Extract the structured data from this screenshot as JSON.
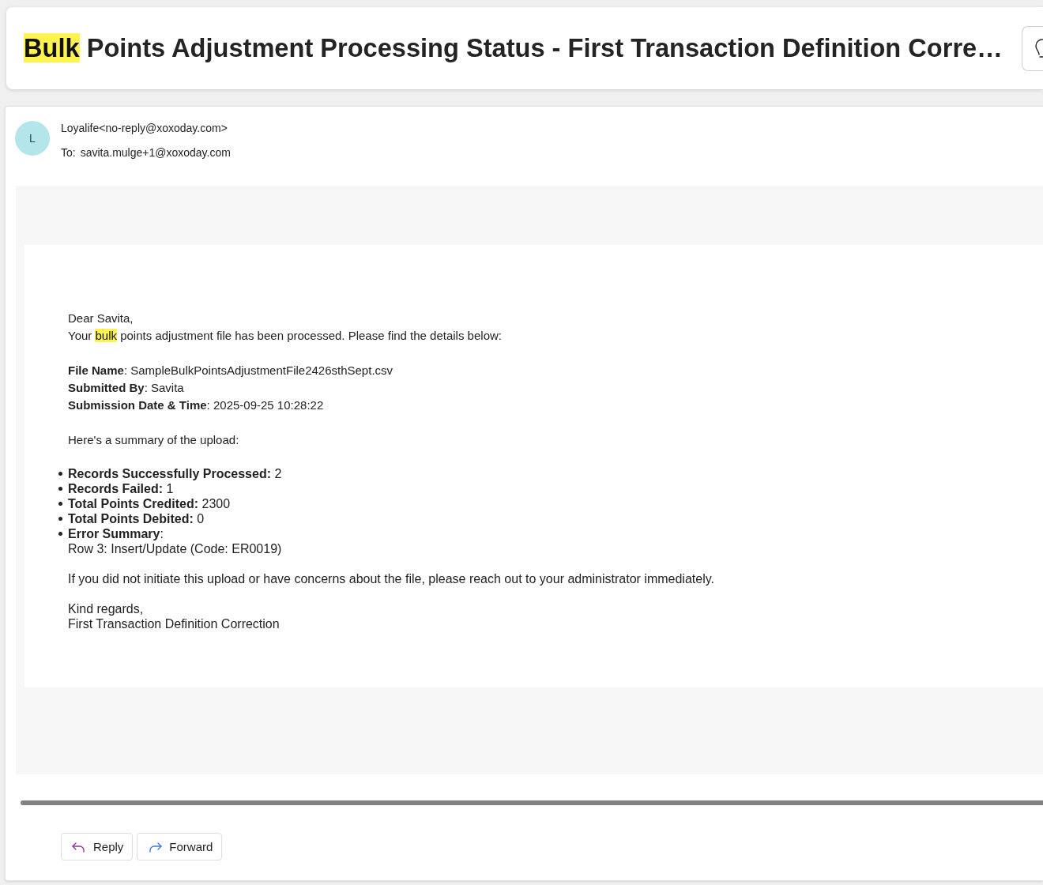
{
  "subject": {
    "parts": [
      {
        "text": "Bulk",
        "highlighted": true
      },
      {
        "text": " Points Adjustment Processing Status - First Transaction Definition Corre…",
        "highlighted": false
      }
    ]
  },
  "message": {
    "avatar_initial": "L",
    "sender": "Loyalife<no-reply@xoxoday.com>",
    "to_label": "To:",
    "recipient": "savita.mulge+1@xoxoday.com"
  },
  "body": {
    "greeting": "Dear Savita,",
    "intro": [
      {
        "text": "Your ",
        "highlighted": false
      },
      {
        "text": "bulk",
        "highlighted": true
      },
      {
        "text": " points adjustment file has been processed. Please find the details below:",
        "highlighted": false
      }
    ],
    "details": [
      "**File Name**: SampleBulkPointsAdjustmentFile2426sthSept.csv",
      "**Submitted By**: Savita",
      "**Submission Date & Time**: 2025-09-25 10:28:22"
    ],
    "summary_intro": "Here's a summary of the upload:",
    "summary_items": [
      {
        "text": "**Records Successfully Processed:** 2"
      },
      {
        "text": "**Records Failed:** 1"
      },
      {
        "text": "**Total Points Credited:** 2300"
      },
      {
        "text": "**Total Points Debited:** 0"
      },
      {
        "text": "**Error Summary**:",
        "detail": "Row 3: Insert/Update (Code: ER0019)"
      }
    ],
    "notice": "If you did not initiate this upload or have concerns about the file, please reach out to your administrator immediately.",
    "closing": "Kind regards,",
    "signature": "First Transaction Definition Correction"
  },
  "actions": [
    {
      "kind": "reply",
      "label": "Reply"
    },
    {
      "kind": "forward",
      "label": "Forward"
    }
  ]
}
